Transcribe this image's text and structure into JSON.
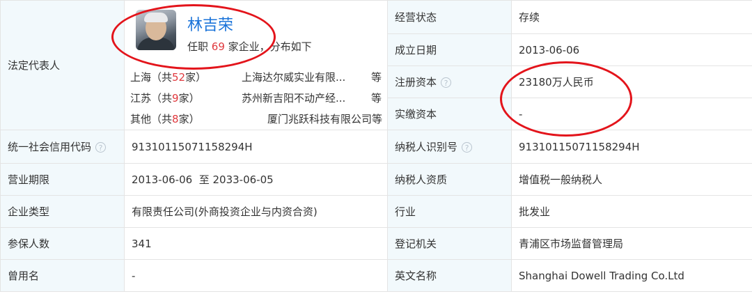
{
  "legal_rep": {
    "label": "法定代表人",
    "name": "林吉荣",
    "post_prefix": "任职",
    "post_count": "69",
    "post_suffix": "家企业，分布如下",
    "regions": [
      {
        "region_prefix": "上海（共",
        "count": "52",
        "region_suffix": "家）",
        "company": "上海达尔威实业有限...",
        "more": "等"
      },
      {
        "region_prefix": "江苏（共",
        "count": "9",
        "region_suffix": "家）",
        "company": "苏州新吉阳不动产经...",
        "more": "等"
      },
      {
        "region_prefix": "其他（共",
        "count": "8",
        "region_suffix": "家）",
        "company": "厦门兆跃科技有限公司等",
        "more": ""
      }
    ]
  },
  "right_top": [
    {
      "label": "经营状态",
      "value": "存续",
      "help": false
    },
    {
      "label": "成立日期",
      "value": "2013-06-06",
      "help": false
    },
    {
      "label": "注册资本",
      "value": "23180万人民币",
      "help": true
    },
    {
      "label": "实缴资本",
      "value": "-",
      "help": false
    }
  ],
  "rows": [
    {
      "l_label": "统一社会信用代码",
      "l_help": true,
      "l_value": "91310115071158294H",
      "r_label": "纳税人识别号",
      "r_help": true,
      "r_value": "91310115071158294H"
    },
    {
      "l_label": "营业期限",
      "l_help": false,
      "l_value": "2013-06-06  至 2033-06-05",
      "r_label": "纳税人资质",
      "r_help": false,
      "r_value": "增值税一般纳税人"
    },
    {
      "l_label": "企业类型",
      "l_help": false,
      "l_value": "有限责任公司(外商投资企业与内资合资)",
      "r_label": "行业",
      "r_help": false,
      "r_value": "批发业"
    },
    {
      "l_label": "参保人数",
      "l_help": false,
      "l_value": "341",
      "r_label": "登记机关",
      "r_help": false,
      "r_value": "青浦区市场监督管理局"
    },
    {
      "l_label": "曾用名",
      "l_help": false,
      "l_value": "-",
      "r_label": "英文名称",
      "r_help": false,
      "r_value": "Shanghai Dowell Trading Co.Ltd"
    }
  ],
  "help_icon": "?",
  "colors": {
    "label_bg": "#f2f9fc",
    "link": "#1a73d9",
    "highlight": "#e0393e",
    "annotation_ring": "#e3141b"
  }
}
